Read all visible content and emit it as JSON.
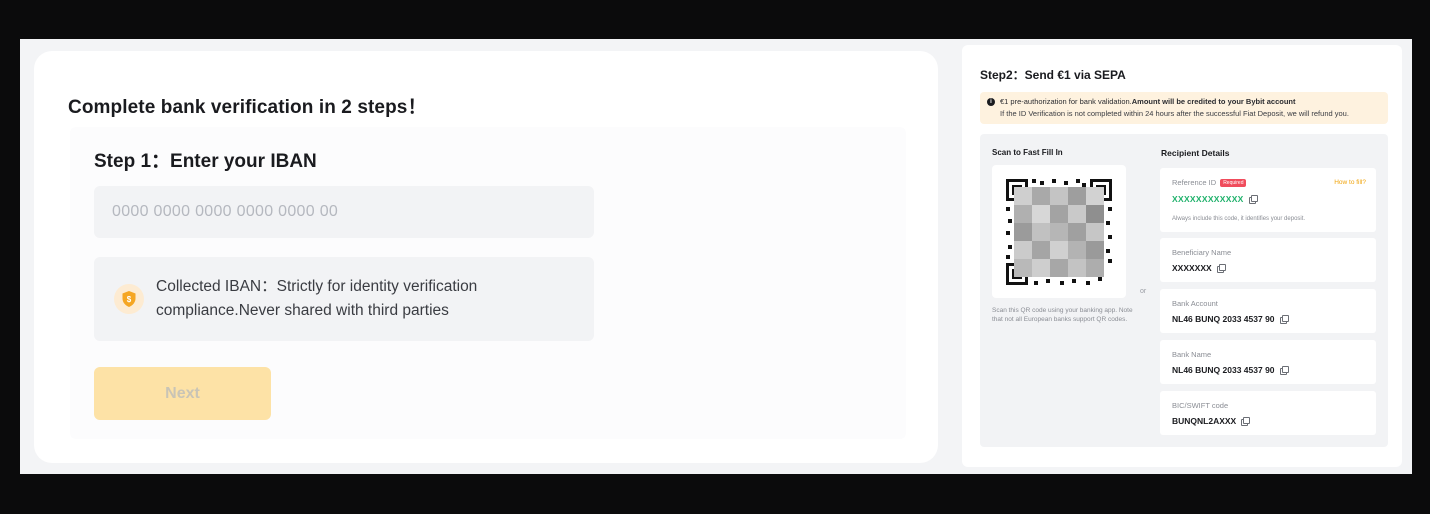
{
  "left": {
    "title": "Complete bank verification in 2 steps！",
    "step1_title": "Step 1：Enter your IBAN",
    "iban_placeholder": "0000 0000 0000 0000 0000 00",
    "iban_value": "",
    "notice_text": "Collected IBAN：Strictly for identity verification compliance.Never shared with third parties",
    "next_label": "Next"
  },
  "right": {
    "step2_title": "Step2：Send €1 via SEPA",
    "alert": {
      "line1_prefix": "€1 pre-authorization for bank validation.",
      "line1_bold": "Amount will be credited to your Bybit account",
      "line2": "If the ID Verification is not completed within 24 hours after the successful Fiat Deposit, we will refund you."
    },
    "qr": {
      "label": "Scan to Fast Fill In",
      "note": "Scan this QR code using your banking app. Note that not all European banks support QR codes."
    },
    "or_label": "or",
    "recipient": {
      "title": "Recipient Details",
      "reference": {
        "label": "Reference ID",
        "badge": "Required",
        "howto": "How to fill?",
        "value": "XXXXXXXXXXXX",
        "hint": "Always include this code, it identifies your deposit."
      },
      "beneficiary": {
        "label": "Beneficiary Name",
        "value": "XXXXXXX"
      },
      "account": {
        "label": "Bank Account",
        "value": "NL46 BUNQ 2033 4537 90"
      },
      "bank_name": {
        "label": "Bank Name",
        "value": "NL46 BUNQ 2033 4537 90"
      },
      "bic": {
        "label": "BIC/SWIFT code",
        "value": "BUNQNL2AXXX"
      }
    }
  },
  "colors": {
    "accent_yellow": "#fde2a6",
    "reference_green": "#20b26c",
    "required_red": "#f04c5c",
    "howto_orange": "#f0a30a",
    "alert_bg": "#fef2df"
  },
  "icons": [
    "shield-dollar-icon",
    "info-icon",
    "copy-icon",
    "qr-code-icon"
  ]
}
